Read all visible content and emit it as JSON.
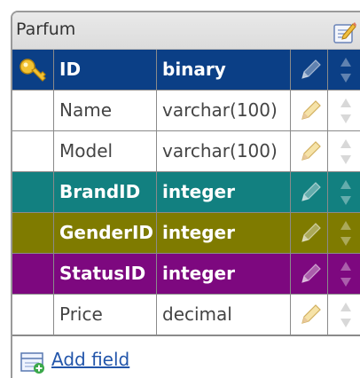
{
  "table": {
    "title": "Parfum",
    "fields": [
      {
        "name": "ID",
        "type": "binary",
        "style": "pk",
        "color": "#0b3f86",
        "key": true
      },
      {
        "name": "Name",
        "type": "varchar(100)",
        "style": "plain",
        "color": "#ffffff",
        "key": false
      },
      {
        "name": "Model",
        "type": "varchar(100)",
        "style": "plain",
        "color": "#ffffff",
        "key": false
      },
      {
        "name": "BrandID",
        "type": "integer",
        "style": "fk",
        "color": "#128080",
        "key": false
      },
      {
        "name": "GenderID",
        "type": "integer",
        "style": "fk",
        "color": "#7f7b00",
        "key": false
      },
      {
        "name": "StatusID",
        "type": "integer",
        "style": "fk",
        "color": "#7d087f",
        "key": false
      },
      {
        "name": "Price",
        "type": "decimal",
        "style": "plain",
        "color": "#ffffff",
        "key": false
      }
    ],
    "add_field_label": "Add field"
  },
  "icons": {
    "edit_table": "edit-table-icon",
    "primary_key": "key-icon",
    "edit_field": "pencil-icon",
    "reorder": "sort-arrows-icon",
    "add_field": "add-field-icon"
  }
}
